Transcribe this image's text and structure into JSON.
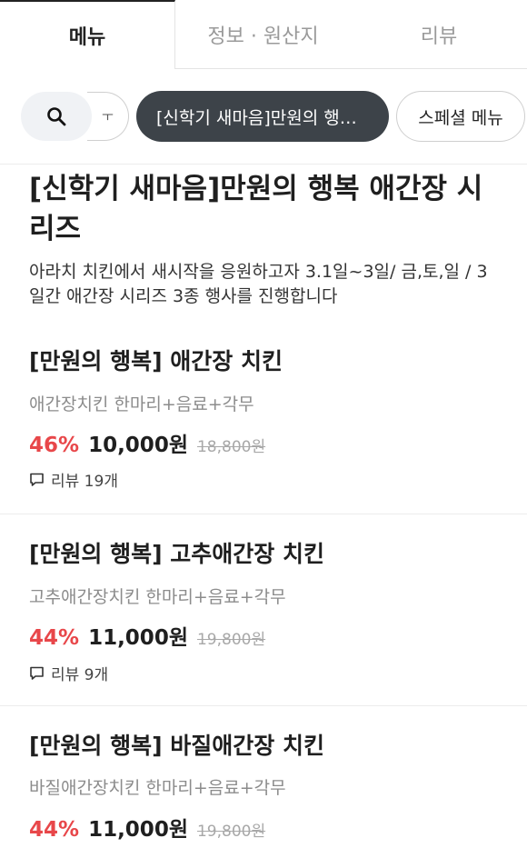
{
  "tabs": [
    {
      "label": "메뉴"
    },
    {
      "label": "정보 · 원산지"
    },
    {
      "label": "리뷰"
    }
  ],
  "chips": {
    "partial_label": "ㅜ",
    "active_label": "[신학기 새마음]만원의 행복 애간장 시리즈",
    "next_label": "스페셜 메뉴"
  },
  "category": {
    "title": "[신학기 새마음]만원의 행복 애간장 시리즈",
    "description": "아라치 치킨에서 새시작을 응원하고자 3.1일~3일/ 금,토,일 / 3일간 애간장 시리즈 3종 행사를 진행합니다"
  },
  "items": [
    {
      "name": "[만원의 행복] 애간장 치킨",
      "description": "애간장치킨 한마리+음료+각무",
      "discount": "46%",
      "price": "10,000원",
      "original_price": "18,800원",
      "review": "리뷰 19개"
    },
    {
      "name": "[만원의 행복] 고추애간장 치킨",
      "description": "고추애간장치킨 한마리+음료+각무",
      "discount": "44%",
      "price": "11,000원",
      "original_price": "19,800원",
      "review": "리뷰 9개"
    },
    {
      "name": "[만원의 행복] 바질애간장 치킨",
      "description": "바질애간장치킨 한마리+음료+각무",
      "discount": "44%",
      "price": "11,000원",
      "original_price": "19,800원"
    }
  ],
  "colors": {
    "discount": "#e8474a",
    "active_chip_bg": "#3d4349"
  },
  "icons": [
    "search-icon",
    "review-bubble-icon"
  ]
}
